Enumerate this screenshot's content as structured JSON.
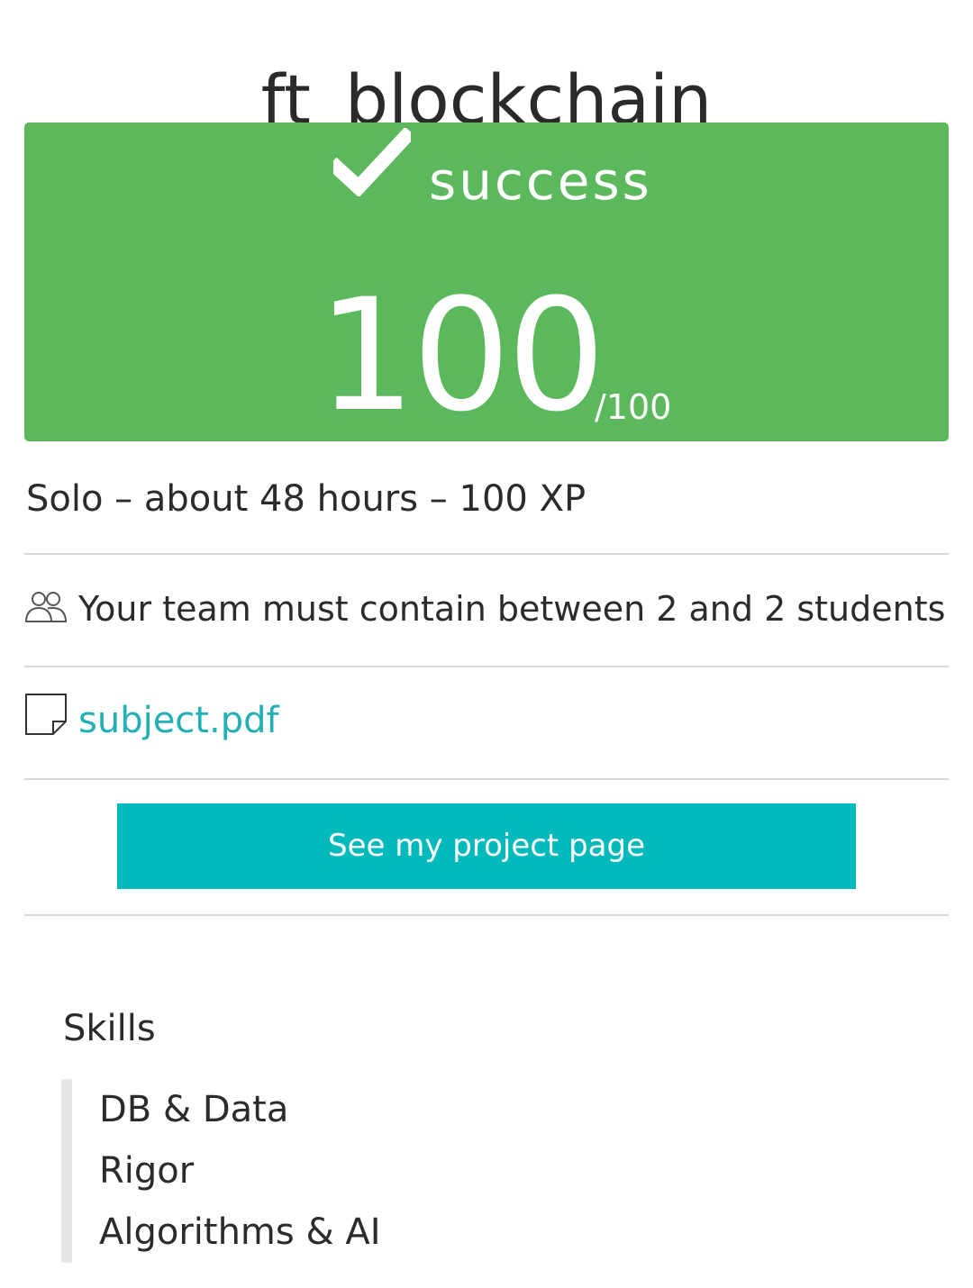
{
  "project": {
    "title": "ft_blockchain"
  },
  "result": {
    "status": "success",
    "status_icon": "checkmark-icon",
    "score": "100",
    "score_max": "/100",
    "color": "#5cb85c"
  },
  "details": {
    "meta": "Solo – about 48 hours – 100 XP",
    "team_icon": "team-users-icon",
    "team_text": "Your team must contain between 2 and 2 students",
    "subject_icon": "document-icon",
    "subject_link": "subject.pdf",
    "link_color": "#22b0b5"
  },
  "actions": {
    "project_page_label": "See my project page",
    "button_color": "#02b9bc"
  },
  "skills": {
    "heading": "Skills",
    "items": [
      "DB & Data",
      "Rigor",
      "Algorithms & AI"
    ]
  }
}
